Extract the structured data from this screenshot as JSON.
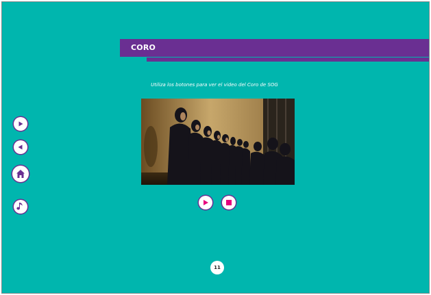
{
  "header": {
    "title": "CORO"
  },
  "instruction": "Utiliza los botones para  ver el video del Coro de SOG",
  "video": {
    "alt": "Coro de SOG"
  },
  "nav": {
    "next_icon": "play-right-icon",
    "prev_icon": "play-left-icon",
    "home_icon": "home-icon",
    "music_icon": "music-note-icon"
  },
  "controls": {
    "play_icon": "play-icon",
    "stop_icon": "stop-icon"
  },
  "page": {
    "number": "11"
  },
  "colors": {
    "background": "#00b6ae",
    "accent": "#6a2f92",
    "pink": "#e6007e"
  }
}
